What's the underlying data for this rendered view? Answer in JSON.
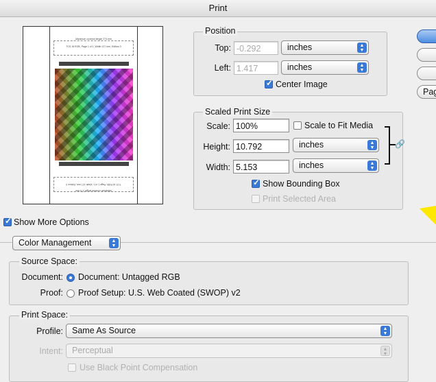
{
  "window": {
    "title": "Print"
  },
  "preview": {
    "header_line1": "Maximum covered length 274 mm",
    "header_line2": "TCS 16 RGB, Page 1 of 1, Width 127 mm, Edition 3",
    "footer_line1": "TCS 16 RGB, Page 1 of 1, Width 127 mm, Edition 3",
    "footer_line2": "Maximum covered length 274 mm"
  },
  "position": {
    "legend": "Position",
    "top_label": "Top:",
    "top_value": "-0.292",
    "top_unit": "inches",
    "left_label": "Left:",
    "left_value": "1.417",
    "left_unit": "inches",
    "center_image_label": "Center Image",
    "center_image_checked": true
  },
  "scaled": {
    "legend": "Scaled Print Size",
    "scale_label": "Scale:",
    "scale_value": "100%",
    "fit_media_label": "Scale to Fit Media",
    "height_label": "Height:",
    "height_value": "10.792",
    "height_unit": "inches",
    "width_label": "Width:",
    "width_value": "5.153",
    "width_unit": "inches",
    "bounding_box_label": "Show Bounding Box",
    "print_selected_label": "Print Selected Area"
  },
  "right_buttons": {
    "page_label": "Pag"
  },
  "more_options": {
    "label": "Show More Options",
    "checked": true
  },
  "color_mgmt": {
    "popup_label": "Color Management"
  },
  "source_space": {
    "legend": "Source Space:",
    "document_label": "Document:",
    "document_option": "Document:  Untagged RGB",
    "proof_label": "Proof:",
    "proof_option": "Proof Setup:  U.S. Web Coated (SWOP) v2"
  },
  "print_space": {
    "legend": "Print Space:",
    "profile_label": "Profile:",
    "profile_value": "Same As Source",
    "intent_label": "Intent:",
    "intent_value": "Perceptual",
    "bpc_label": "Use Black Point Compensation"
  },
  "colors": {
    "accent": "#3a79d6",
    "highlight": "#ffe800"
  }
}
